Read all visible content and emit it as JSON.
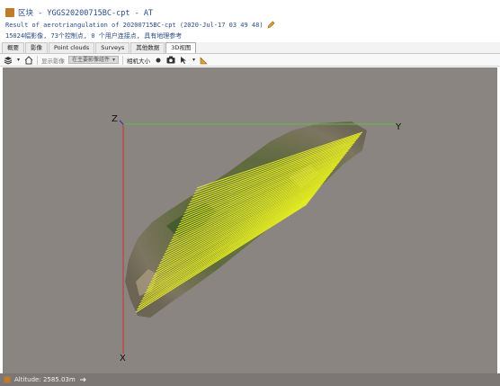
{
  "window": {
    "title": "区块 - YGGS20200715BC-cpt - AT",
    "subtitle": "Result of aerotriangulation of 20200715BC-cpt (2020-Jul-17 03 49 48)",
    "stats": "15024幅影像, 73个控制点, 0 个用户连接点, 具有地理参考"
  },
  "tabs": [
    {
      "label": "概要"
    },
    {
      "label": "影像"
    },
    {
      "label": "Point clouds"
    },
    {
      "label": "Surveys"
    },
    {
      "label": "其他数据"
    },
    {
      "label": "3D视图"
    }
  ],
  "toolbar": {
    "display_label": "显示影像",
    "select_value": "在主要影像组件",
    "camera_size_label": "相机大小"
  },
  "viewport": {
    "axis_z": "Z",
    "axis_y": "Y",
    "axis_x": "X",
    "background": "#8b8581",
    "flight_line_color": "#e8f020",
    "y_axis_color": "#5bbf3a",
    "x_axis_color": "#d03030"
  },
  "status": {
    "altitude": "Altitude: 2585.03m"
  }
}
